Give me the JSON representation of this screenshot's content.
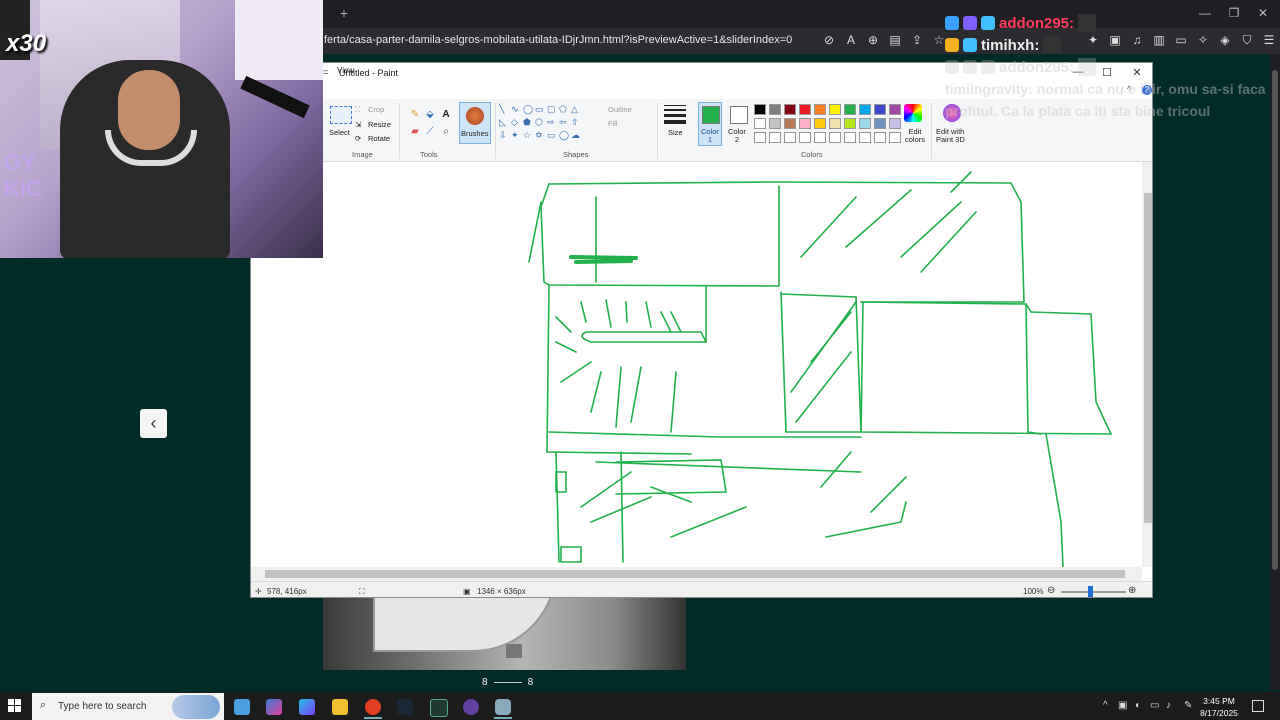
{
  "overlay": {
    "multiplier": "x30",
    "side_text": "GY\nKIC"
  },
  "browser": {
    "url": "ferta/casa-parter-damila-selgros-mobilata-utilata-IDjrJmn.html?isPreviewActive=1&sliderIndex=0",
    "new_tab": "+"
  },
  "chat": {
    "lines": [
      {
        "user": "addon295:",
        "color": "#ff3b5c"
      },
      {
        "user": "timihxh:",
        "color": "#eeeeee"
      },
      {
        "user": "addon295:",
        "color": "faded"
      }
    ],
    "message_user": "timilngravity:",
    "message_text": "normal ca nu e fair, omu sa-si faca profitul. Ca la plata ca iti sta bine tricoul"
  },
  "paint": {
    "title": "Untitled - Paint",
    "menu_tab": "View",
    "ribbon": {
      "image_group": "Image",
      "select": "Select",
      "crop": "Crop",
      "resize": "Resize",
      "rotate": "Rotate",
      "tools_group": "Tools",
      "brushes": "Brushes",
      "shapes_group": "Shapes",
      "outline": "Outline",
      "fill": "Fill",
      "size": "Size",
      "color1": "Color\n1",
      "color2": "Color\n2",
      "colors_group": "Colors",
      "edit_colors": "Edit\ncolors",
      "edit_paint3d": "Edit with\nPaint 3D"
    },
    "palette": [
      "#000000",
      "#7f7f7f",
      "#880015",
      "#ed1c24",
      "#ff7f27",
      "#fff200",
      "#22b14c",
      "#00a2e8",
      "#3f48cc",
      "#a349a4",
      "#ffffff",
      "#c3c3c3",
      "#b97a57",
      "#ffaec9",
      "#ffc90e",
      "#efe4b0",
      "#b5e61d",
      "#99d9ea",
      "#7092be",
      "#c8bfe7",
      "#ffffff",
      "#ffffff",
      "#ffffff",
      "#ffffff",
      "#ffffff",
      "#ffffff",
      "#ffffff",
      "#ffffff",
      "#ffffff",
      "#ffffff"
    ],
    "color1_hex": "#22b14c",
    "status": {
      "cursor_pos": "578, 416px",
      "canvas_size": "1346 × 636px",
      "zoom": "100%"
    }
  },
  "page": {
    "pager_left": "8",
    "pager_right": "8"
  },
  "taskbar": {
    "search_placeholder": "Type here to search",
    "time": "3:45 PM",
    "date": "8/17/2025"
  }
}
